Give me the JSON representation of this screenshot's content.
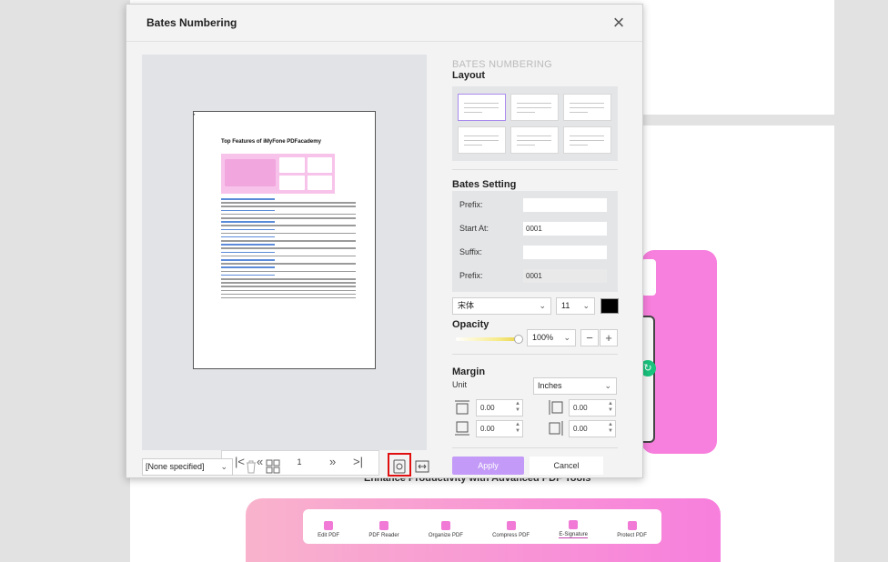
{
  "background": {
    "heading": "Enhance Productivity with Advanced PDF Tools",
    "tabs": [
      {
        "label": "Edit PDF",
        "active": false
      },
      {
        "label": "PDF Reader",
        "active": false
      },
      {
        "label": "Organize PDF",
        "active": false
      },
      {
        "label": "Compress PDF",
        "active": false
      },
      {
        "label": "E-Signature",
        "active": true
      },
      {
        "label": "Protect PDF",
        "active": false
      }
    ],
    "colors": {
      "pink": "#f77fdd",
      "green": "#19c37d"
    }
  },
  "dialog": {
    "title": "Bates Numbering",
    "close_icon": "close-icon",
    "preview": {
      "doc_title": "Top Features of iMyFone PDFacademy",
      "pager": {
        "current_page": "1"
      }
    },
    "settings": {
      "ghost_heading": "BATES NUMBERING",
      "layout_title": "Layout",
      "layout_selected_index": 0,
      "bates_title": "Bates Setting",
      "fields": {
        "prefix_label": "Prefix:",
        "prefix_value": "",
        "start_label": "Start At:",
        "start_value": "0001",
        "suffix_label": "Suffix:",
        "suffix_value": "",
        "preview_label": "Prefix:",
        "preview_value": "0001"
      },
      "font": {
        "family": "宋体",
        "size": "11",
        "color": "#000000"
      },
      "opacity_title": "Opacity",
      "opacity_value": "100%",
      "margin_title": "Margin",
      "unit_label": "Unit",
      "unit_value": "Inches",
      "margins": {
        "top": "0.00",
        "left": "0.00",
        "bottom": "0.00",
        "right": "0.00"
      },
      "accent_color": "#c39af7"
    },
    "footer": {
      "preset_value": "[None specified]",
      "apply_label": "Apply",
      "cancel_label": "Cancel"
    }
  }
}
